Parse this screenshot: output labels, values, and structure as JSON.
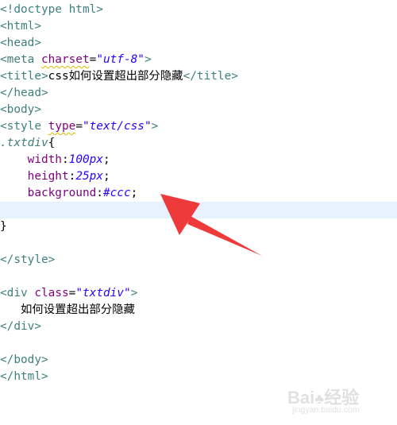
{
  "editor": {
    "lines": [
      {
        "id": "doctype",
        "tokens": [
          {
            "k": "tag",
            "t": "<!doctype html>"
          }
        ]
      },
      {
        "id": "html-open",
        "tokens": [
          {
            "k": "tag",
            "t": "<html>"
          }
        ]
      },
      {
        "id": "head-open",
        "tokens": [
          {
            "k": "tag",
            "t": "<head>"
          }
        ]
      },
      {
        "id": "meta",
        "tokens": [
          {
            "k": "tag",
            "t": "<meta "
          },
          {
            "k": "attr",
            "t": "charset"
          },
          {
            "k": "txt",
            "t": "="
          },
          {
            "k": "str",
            "t": "\"utf-8\""
          },
          {
            "k": "tag",
            "t": ">"
          }
        ]
      },
      {
        "id": "title",
        "tokens": [
          {
            "k": "tag",
            "t": "<title>"
          },
          {
            "k": "txt",
            "t": "css"
          },
          {
            "k": "cjk",
            "t": "如何设置超出部分隐藏"
          },
          {
            "k": "tag",
            "t": "</title>"
          }
        ]
      },
      {
        "id": "head-close",
        "tokens": [
          {
            "k": "tag",
            "t": "</head>"
          }
        ]
      },
      {
        "id": "body-open",
        "tokens": [
          {
            "k": "tag",
            "t": "<body>"
          }
        ]
      },
      {
        "id": "style-open",
        "tokens": [
          {
            "k": "tag",
            "t": "<style "
          },
          {
            "k": "attr",
            "t": "type"
          },
          {
            "k": "txt",
            "t": "="
          },
          {
            "k": "str",
            "t": "\"text/css\""
          },
          {
            "k": "tag",
            "t": ">"
          }
        ]
      },
      {
        "id": "selector",
        "tokens": [
          {
            "k": "sel",
            "t": ".txtdiv"
          },
          {
            "k": "txt",
            "t": "{"
          }
        ]
      },
      {
        "id": "prop-width",
        "tokens": [
          {
            "k": "txt",
            "t": "    "
          },
          {
            "k": "prop",
            "t": "width"
          },
          {
            "k": "txt",
            "t": ":"
          },
          {
            "k": "val",
            "t": "100px"
          },
          {
            "k": "txt",
            "t": ";"
          }
        ]
      },
      {
        "id": "prop-height",
        "tokens": [
          {
            "k": "txt",
            "t": "    "
          },
          {
            "k": "prop",
            "t": "height"
          },
          {
            "k": "txt",
            "t": ":"
          },
          {
            "k": "val",
            "t": "25px"
          },
          {
            "k": "txt",
            "t": ";"
          }
        ]
      },
      {
        "id": "prop-background",
        "tokens": [
          {
            "k": "txt",
            "t": "    "
          },
          {
            "k": "prop",
            "t": "background"
          },
          {
            "k": "txt",
            "t": ":"
          },
          {
            "k": "val",
            "t": "#ccc"
          },
          {
            "k": "txt",
            "t": ";"
          }
        ]
      },
      {
        "id": "empty-current",
        "current": true,
        "tokens": []
      },
      {
        "id": "brace-close",
        "tokens": [
          {
            "k": "txt",
            "t": "}"
          }
        ]
      },
      {
        "id": "blank-1",
        "tokens": []
      },
      {
        "id": "style-close",
        "tokens": [
          {
            "k": "tag",
            "t": "</style>"
          }
        ]
      },
      {
        "id": "blank-2",
        "tokens": []
      },
      {
        "id": "div-open",
        "tokens": [
          {
            "k": "tag",
            "t": "<div "
          },
          {
            "k": "attr",
            "t": "class"
          },
          {
            "k": "txt",
            "t": "="
          },
          {
            "k": "str",
            "t": "\"txtdiv\""
          },
          {
            "k": "tag",
            "t": ">"
          }
        ]
      },
      {
        "id": "div-text",
        "tokens": [
          {
            "k": "txt",
            "t": "   "
          },
          {
            "k": "cjk",
            "t": "如何设置超出部分隐藏"
          }
        ]
      },
      {
        "id": "div-close",
        "tokens": [
          {
            "k": "tag",
            "t": "</div>"
          }
        ]
      },
      {
        "id": "blank-3",
        "tokens": []
      },
      {
        "id": "body-close",
        "tokens": [
          {
            "k": "tag",
            "t": "</body>"
          }
        ]
      },
      {
        "id": "html-close",
        "tokens": [
          {
            "k": "tag",
            "t": "</html>"
          }
        ]
      }
    ],
    "squiggle_tokens": [
      "charset",
      "type"
    ]
  },
  "annotation": {
    "arrow_color": "#ee3a3a",
    "arrow_icon": "red-arrow-icon"
  },
  "watermark": {
    "brand": "Bai",
    "brand_tail": "经验",
    "url": "jingyan.baidu.com"
  },
  "colors": {
    "tag": "#3f7f7f",
    "attribute": "#7f007f",
    "string": "#2a00ff",
    "current_line": "#e8f2fe"
  }
}
